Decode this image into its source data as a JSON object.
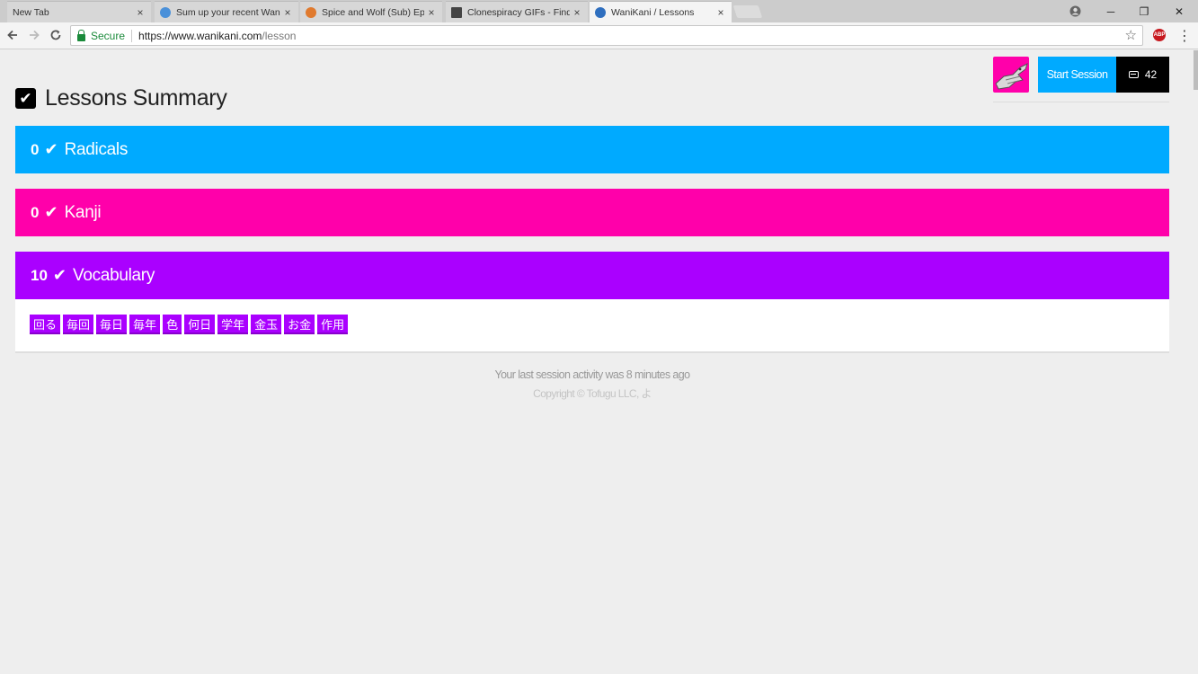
{
  "browser": {
    "tabs": [
      {
        "title": "New Tab",
        "favicon_color": ""
      },
      {
        "title": "Sum up your recent Wan",
        "favicon_color": "#4a90d9"
      },
      {
        "title": "Spice and Wolf (Sub) Epi",
        "favicon_color": "#e07a2e"
      },
      {
        "title": "Clonespiracy GIFs - Find",
        "favicon_color": "#444444"
      },
      {
        "title": "WaniKani / Lessons",
        "favicon_color": "#2f6fbf"
      }
    ],
    "close_glyph": "×",
    "window_controls": {
      "minimize": "─",
      "restore": "❐",
      "close": "✕"
    },
    "secure_label": "Secure",
    "url_host": "https://www.wanikani.com",
    "url_path": "/lesson",
    "abp_label": "ABP"
  },
  "header": {
    "start_session": "Start Session",
    "queue_count": "42"
  },
  "page": {
    "title": "Lessons Summary"
  },
  "colors": {
    "radical": "#00aaff",
    "kanji": "#ff00aa",
    "vocabulary": "#aa00ff"
  },
  "sections": {
    "radicals": {
      "count": "0",
      "label": "Radicals"
    },
    "kanji": {
      "count": "0",
      "label": "Kanji"
    },
    "vocabulary": {
      "count": "10",
      "label": "Vocabulary"
    }
  },
  "vocab_items": [
    "回る",
    "毎回",
    "毎日",
    "毎年",
    "色",
    "何日",
    "学年",
    "金玉",
    "お金",
    "作用"
  ],
  "footer": {
    "activity": "Your last session activity was 8 minutes ago",
    "copyright": "Copyright © Tofugu LLC, よ"
  }
}
